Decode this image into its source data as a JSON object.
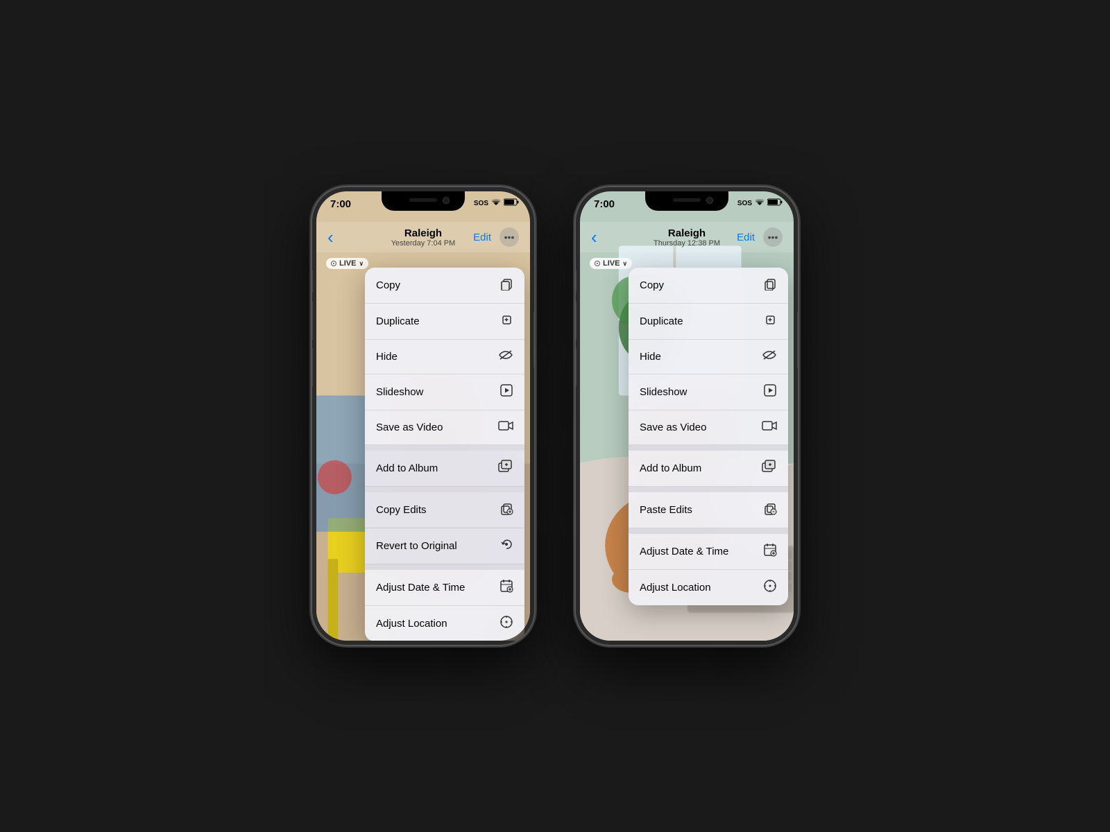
{
  "phones": [
    {
      "id": "left",
      "statusBar": {
        "time": "7:00",
        "sos": "SOS",
        "wifi": "wifi",
        "battery": "battery"
      },
      "navBar": {
        "backLabel": "‹",
        "titleMain": "Raleigh",
        "titleSub": "Yesterday  7:04 PM",
        "editLabel": "Edit",
        "moreLabel": "···"
      },
      "liveBadge": "LIVE",
      "menu": {
        "items": [
          {
            "label": "Copy",
            "icon": "⎘",
            "shaded": false
          },
          {
            "label": "Duplicate",
            "icon": "⊞",
            "shaded": false
          },
          {
            "label": "Hide",
            "icon": "◎̸",
            "shaded": false
          },
          {
            "label": "Slideshow",
            "icon": "▷",
            "shaded": false
          },
          {
            "label": "Save as Video",
            "icon": "⬜",
            "shaded": false
          },
          {
            "label": "separator",
            "icon": "",
            "shaded": false
          },
          {
            "label": "Add to Album",
            "icon": "⊕",
            "shaded": true
          },
          {
            "label": "separator2",
            "icon": "",
            "shaded": false
          },
          {
            "label": "Copy Edits",
            "icon": "⊠",
            "shaded": true
          },
          {
            "label": "Revert to Original",
            "icon": "↺",
            "shaded": true
          },
          {
            "label": "separator3",
            "icon": "",
            "shaded": false
          },
          {
            "label": "Adjust Date & Time",
            "icon": "📅",
            "shaded": false
          },
          {
            "label": "Adjust Location",
            "icon": "ℹ",
            "shaded": false
          }
        ]
      }
    },
    {
      "id": "right",
      "statusBar": {
        "time": "7:00",
        "sos": "SOS",
        "wifi": "wifi",
        "battery": "battery"
      },
      "navBar": {
        "backLabel": "‹",
        "titleMain": "Raleigh",
        "titleSub": "Thursday  12:38 PM",
        "editLabel": "Edit",
        "moreLabel": "···"
      },
      "liveBadge": "LIVE",
      "menu": {
        "items": [
          {
            "label": "Copy",
            "icon": "⎘",
            "shaded": false
          },
          {
            "label": "Duplicate",
            "icon": "⊞",
            "shaded": false
          },
          {
            "label": "Hide",
            "icon": "◎̸",
            "shaded": false
          },
          {
            "label": "Slideshow",
            "icon": "▷",
            "shaded": false
          },
          {
            "label": "Save as Video",
            "icon": "⬜",
            "shaded": false
          },
          {
            "label": "separator",
            "icon": "",
            "shaded": false
          },
          {
            "label": "Add to Album",
            "icon": "⊕",
            "shaded": false
          },
          {
            "label": "separator2",
            "icon": "",
            "shaded": false
          },
          {
            "label": "Paste Edits",
            "icon": "⊠",
            "shaded": false
          },
          {
            "label": "separator3",
            "icon": "",
            "shaded": false
          },
          {
            "label": "Adjust Date & Time",
            "icon": "📅",
            "shaded": false
          },
          {
            "label": "Adjust Location",
            "icon": "ℹ",
            "shaded": false
          }
        ]
      }
    }
  ],
  "icons": {
    "copy": "⎘",
    "duplicate": "⊞",
    "hide": "⊘",
    "slideshow": "▷",
    "save_video": "⬛",
    "add_album": "🖼",
    "copy_edits": "⊡",
    "paste_edits": "⊡",
    "revert": "↺",
    "date_time": "🗓",
    "location": "ⓘ",
    "back_chevron": "‹",
    "more_dots": "•••",
    "live_circle": "◎"
  }
}
